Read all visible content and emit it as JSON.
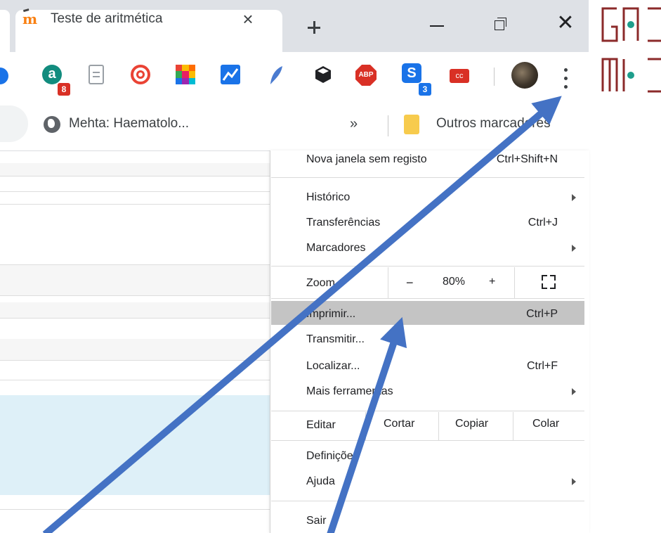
{
  "tabs": {
    "active_title": "Teste de aritmética",
    "close_glyph": "×",
    "new_tab_glyph": "+"
  },
  "window": {
    "minimize": "minimize-icon",
    "restore": "restore-icon",
    "close_glyph": "✕"
  },
  "toolbar": {
    "extensions": [
      {
        "name": "blue-partial-extension-icon",
        "color": "#1a73e8"
      },
      {
        "name": "teal-a-extension-icon",
        "color": "#128c7e",
        "badge": "8",
        "badge_color": "#d93025"
      },
      {
        "name": "document-extension-icon",
        "color": "#9aa0a6"
      },
      {
        "name": "red-spiral-extension-icon",
        "color": "#ea4335"
      },
      {
        "name": "color-grid-extension-icon",
        "color": "#fbbc04"
      },
      {
        "name": "chart-extension-icon",
        "color": "#1a73e8"
      },
      {
        "name": "feather-extension-icon",
        "color": "#4a7bd0"
      },
      {
        "name": "cube-extension-icon",
        "color": "#202124"
      },
      {
        "name": "adblock-plus-extension-icon",
        "color": "#d93025",
        "label": "ABP"
      },
      {
        "name": "blue-s-extension-icon",
        "color": "#1a73e8",
        "badge": "3",
        "badge_color": "#1a73e8"
      },
      {
        "name": "cc-extension-icon",
        "color": "#d93025",
        "label": "cc"
      }
    ]
  },
  "bookmarks": {
    "item1": "Mehta: Haematolo...",
    "overflow_glyph": "»",
    "other_bookmarks": "Outros marcadores"
  },
  "menu": {
    "items": [
      {
        "label": "Nova janela sem registo",
        "shortcut": "Ctrl+Shift+N"
      },
      {
        "label": "Histórico",
        "submenu": true
      },
      {
        "label": "Transferências",
        "shortcut": "Ctrl+J"
      },
      {
        "label": "Marcadores",
        "submenu": true
      },
      {
        "label": "Imprimir...",
        "shortcut": "Ctrl+P",
        "highlighted": true
      },
      {
        "label": "Transmitir..."
      },
      {
        "label": "Localizar...",
        "shortcut": "Ctrl+F"
      },
      {
        "label": "Mais ferramentas",
        "submenu": true
      },
      {
        "label": "Definições"
      },
      {
        "label": "Ajuda",
        "submenu": true
      },
      {
        "label": "Sair"
      }
    ],
    "zoom": {
      "label": "Zoom",
      "minus": "−",
      "value": "80%",
      "plus": "+"
    },
    "edit": {
      "label": "Editar",
      "cut": "Cortar",
      "copy": "Copiar",
      "paste": "Colar"
    }
  },
  "colors": {
    "arrow": "#4472c4",
    "logo": "#8b2a2a",
    "logo_dot": "#1e9e8c",
    "menu_highlight": "#c4c4c4",
    "tabstrip": "#dee1e6"
  },
  "logo": {
    "line1": "GA",
    "line2": "ME"
  }
}
